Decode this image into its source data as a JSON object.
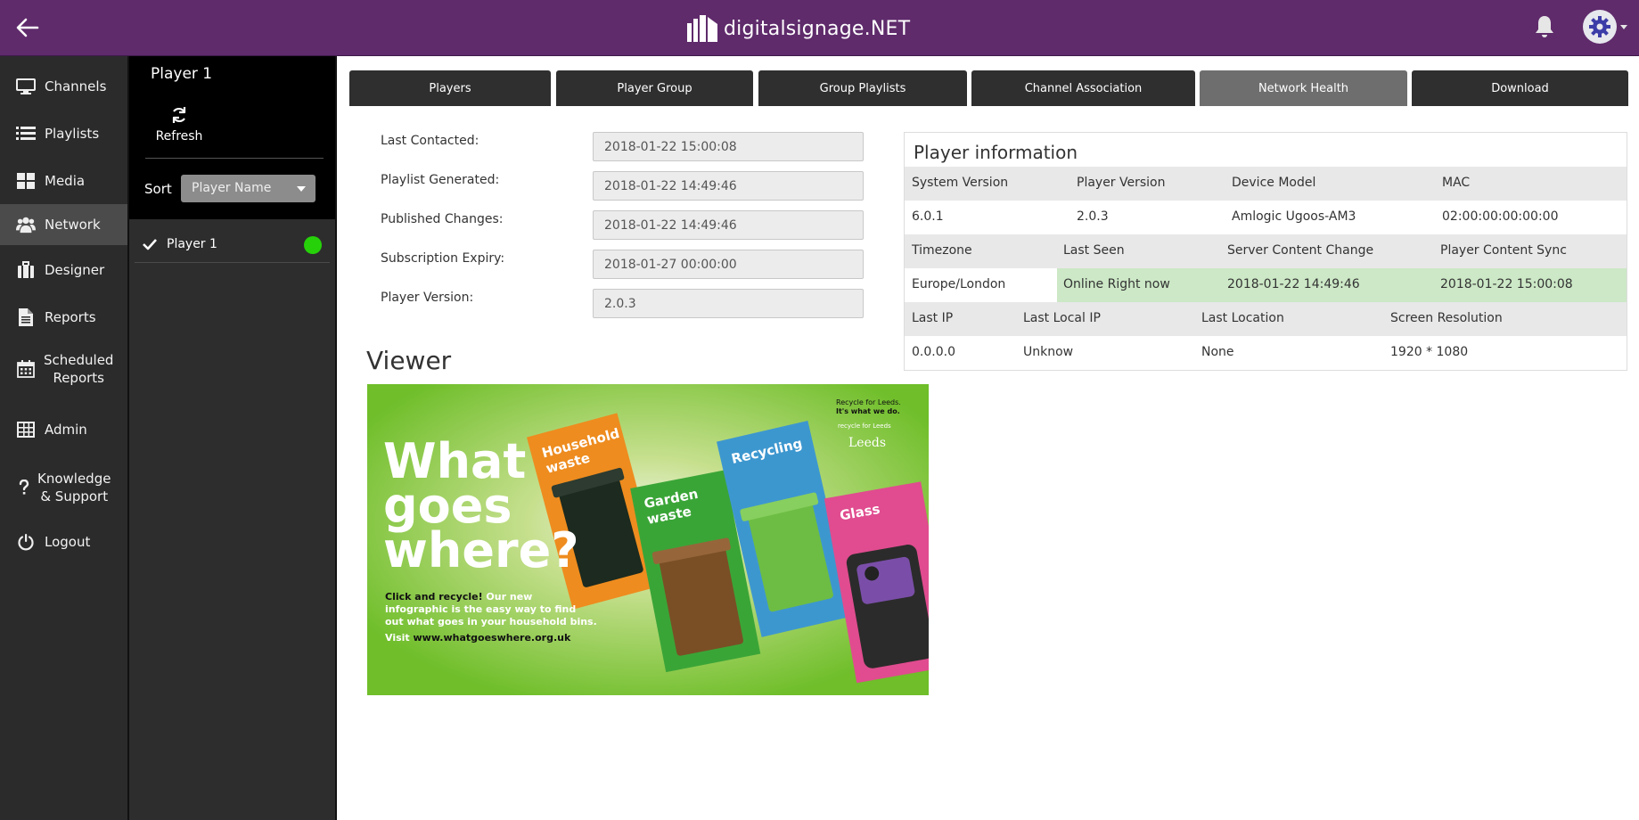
{
  "header": {
    "logo_text": "digitalsignage.NET",
    "icons": [
      "back-arrow-icon",
      "bell-icon",
      "gear-icon"
    ]
  },
  "sidebar": {
    "items": [
      {
        "label": "Channels",
        "icon": "monitor-icon"
      },
      {
        "label": "Playlists",
        "icon": "list-icon"
      },
      {
        "label": "Media",
        "icon": "grid-icon"
      },
      {
        "label": "Network",
        "icon": "users-icon",
        "active": true
      },
      {
        "label": "Designer",
        "icon": "briefcase-icon"
      },
      {
        "label": "Reports",
        "icon": "document-icon"
      },
      {
        "label": "Scheduled",
        "label2": "Reports",
        "icon": "calendar-icon"
      },
      {
        "label": "Admin",
        "icon": "table-icon"
      },
      {
        "label": "Knowledge",
        "label2": "& Support",
        "icon": "question-icon"
      },
      {
        "label": "Logout",
        "icon": "power-icon"
      }
    ]
  },
  "player_panel": {
    "title": "Player 1",
    "refresh_label": "Refresh",
    "sort_label": "Sort",
    "sort_value": "Player Name",
    "players": [
      {
        "name": "Player 1",
        "status_color": "#26d10a"
      }
    ]
  },
  "tabs": [
    {
      "label": "Players"
    },
    {
      "label": "Player Group"
    },
    {
      "label": "Group Playlists"
    },
    {
      "label": "Channel Association"
    },
    {
      "label": "Network Health",
      "active": true
    },
    {
      "label": "Download"
    }
  ],
  "form": {
    "fields": [
      {
        "label": "Last Contacted:",
        "value": "2018-01-22 15:00:08"
      },
      {
        "label": "Playlist Generated:",
        "value": "2018-01-22 14:49:46"
      },
      {
        "label": "Published Changes:",
        "value": "2018-01-22 14:49:46"
      },
      {
        "label": "Subscription Expiry:",
        "value": "2018-01-27 00:00:00"
      },
      {
        "label": "Player Version:",
        "value": "2.0.3"
      }
    ]
  },
  "player_info": {
    "title": "Player information",
    "row1_headers": [
      "System Version",
      "Player Version",
      "Device Model",
      "MAC"
    ],
    "row1_values": [
      "6.0.1",
      "2.0.3",
      "Amlogic Ugoos-AM3",
      "02:00:00:00:00:00"
    ],
    "row2_headers": [
      "Timezone",
      "Last Seen",
      "Server Content Change",
      "Player Content Sync"
    ],
    "row2_values": [
      "Europe/London",
      "Online Right now",
      "2018-01-22 14:49:46",
      "2018-01-22 15:00:08"
    ],
    "row3_headers": [
      "Last IP",
      "Last Local IP",
      "Last Location",
      "Screen Resolution"
    ],
    "row3_values": [
      "0.0.0.0",
      "Unknow",
      "None",
      "1920 * 1080"
    ],
    "online_color": "#cce8c6"
  },
  "viewer": {
    "title": "Viewer",
    "poster": {
      "headline1": "What",
      "headline2": "goes",
      "headline3": "where?",
      "body1a": "Click and recycle!",
      "body1b": " Our new",
      "body2": "infographic is the easy way to find",
      "body3": "out what goes in your household bins.",
      "body4a": "Visit ",
      "body4b": "www.whatgoeswhere.org.uk",
      "brand1": "Recycle for Leeds.",
      "brand2": "It's what we do.",
      "brand3": "recycle for Leeds",
      "brand4": "Leeds",
      "card1a": "Household",
      "card1b": "waste",
      "card2a": "Garden",
      "card2b": "waste",
      "card3": "Recycling",
      "card4": "Glass",
      "colors": {
        "bg": "#6fbe2a",
        "household": "#ee8c1f",
        "garden": "#3aa537",
        "recycling": "#3d97cf",
        "glass": "#e04c8f"
      }
    }
  }
}
